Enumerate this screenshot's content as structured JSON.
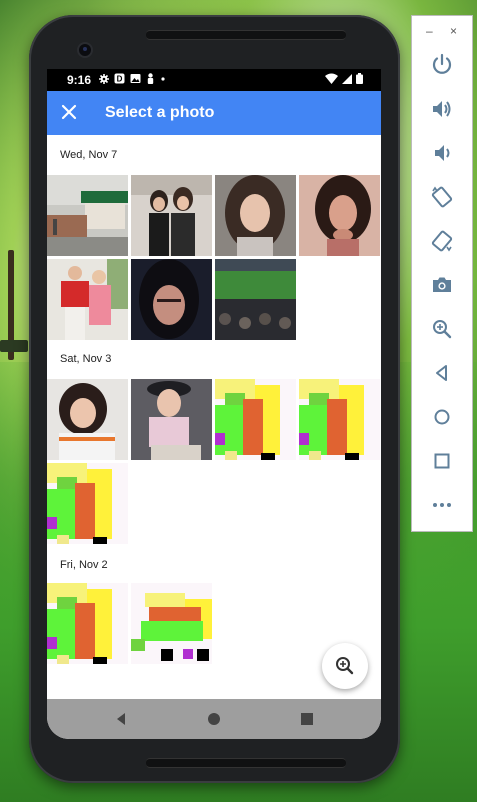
{
  "status_bar": {
    "time": "9:16"
  },
  "app_bar": {
    "title": "Select a photo",
    "close_icon": "close-icon",
    "color": "#4285f4"
  },
  "sections": [
    {
      "label": "Wed, Nov 7",
      "photos": [
        "photo-store-front",
        "photo-two-girls-selfie",
        "photo-woman-long-hair",
        "photo-woman-hand-chin",
        "photo-couple-red-shirt",
        "photo-woman-dark-hair",
        "photo-stadium"
      ]
    },
    {
      "label": "Sat, Nov 3",
      "photos": [
        "photo-girl-striped-shirt",
        "photo-woman-hat",
        "pixel-art-tile",
        "pixel-art-tile",
        "pixel-art-tile"
      ]
    },
    {
      "label": "Fri, Nov 2",
      "photos": [
        "pixel-art-tile",
        "pixel-art-tile-variant"
      ]
    }
  ],
  "fab": {
    "icon": "zoom-in-icon"
  },
  "nav_bar": {
    "icons": [
      "back-icon",
      "home-icon",
      "recents-icon"
    ]
  },
  "emulator_panel": {
    "icons": [
      "power-icon",
      "volume-up-icon",
      "volume-down-icon",
      "rotate-left-icon",
      "rotate-right-icon",
      "camera-icon",
      "zoom-icon",
      "back-icon",
      "home-icon",
      "overview-icon",
      "more-icon"
    ],
    "minimize": "–",
    "close": "×"
  }
}
